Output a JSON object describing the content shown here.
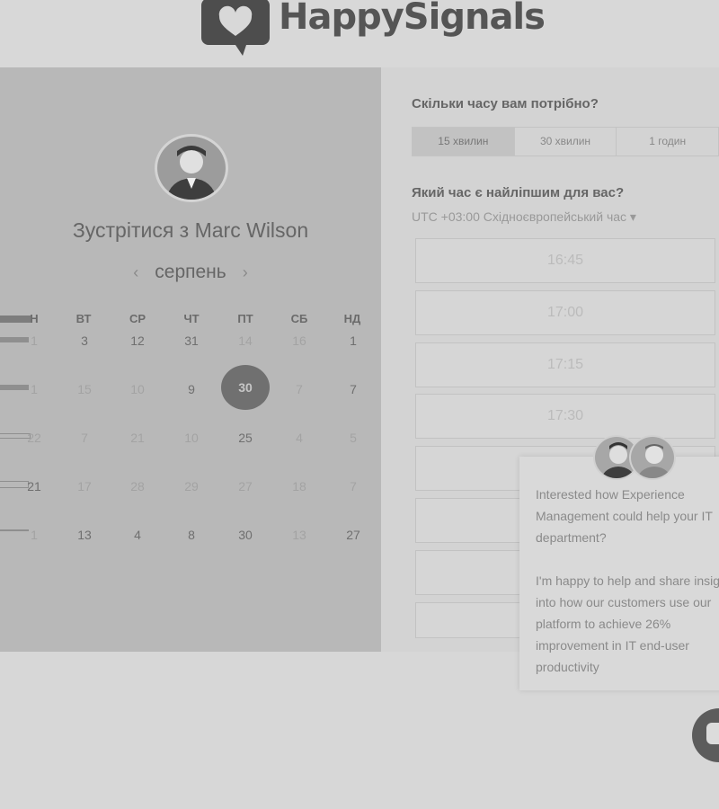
{
  "brand": {
    "name": "HappySignals"
  },
  "calendar": {
    "title": "Зустрітися з Marc Wilson",
    "month": "серпень",
    "prev_icon": "chevron-left-icon",
    "next_icon": "chevron-right-icon",
    "weekdays": [
      "Н",
      "ВТ",
      "СР",
      "ЧТ",
      "ПТ",
      "СБ",
      "НД"
    ],
    "rows": [
      [
        "1",
        "3",
        "12",
        "31",
        "14",
        "16",
        "1"
      ],
      [
        "1",
        "15",
        "10",
        "9",
        "30",
        "7",
        "7"
      ],
      [
        "22",
        "7",
        "21",
        "10",
        "25",
        "4",
        "5"
      ],
      [
        "21",
        "17",
        "28",
        "29",
        "27",
        "18",
        "7"
      ],
      [
        "1",
        "13",
        "4",
        "8",
        "30",
        "13",
        "27"
      ]
    ],
    "selected_day": "30"
  },
  "booking": {
    "duration_question": "Скільки часу вам потрібно?",
    "durations": [
      "15 хвилин",
      "30 хвилин",
      "1 годин"
    ],
    "time_question": "Який час є найліпшим для вас?",
    "timezone": "UTC +03:00 Східноєвропейський час ▾",
    "slots": [
      "16:45",
      "17:00",
      "17:15",
      "17:30"
    ]
  },
  "chat": {
    "message": "Interested how Experience Management could help your IT department?\n\nI'm happy to help and share insight into how our customers use our platform to achieve 26% improvement in IT end-user productivity",
    "launcher_icon": "chat-bubble-icon"
  }
}
